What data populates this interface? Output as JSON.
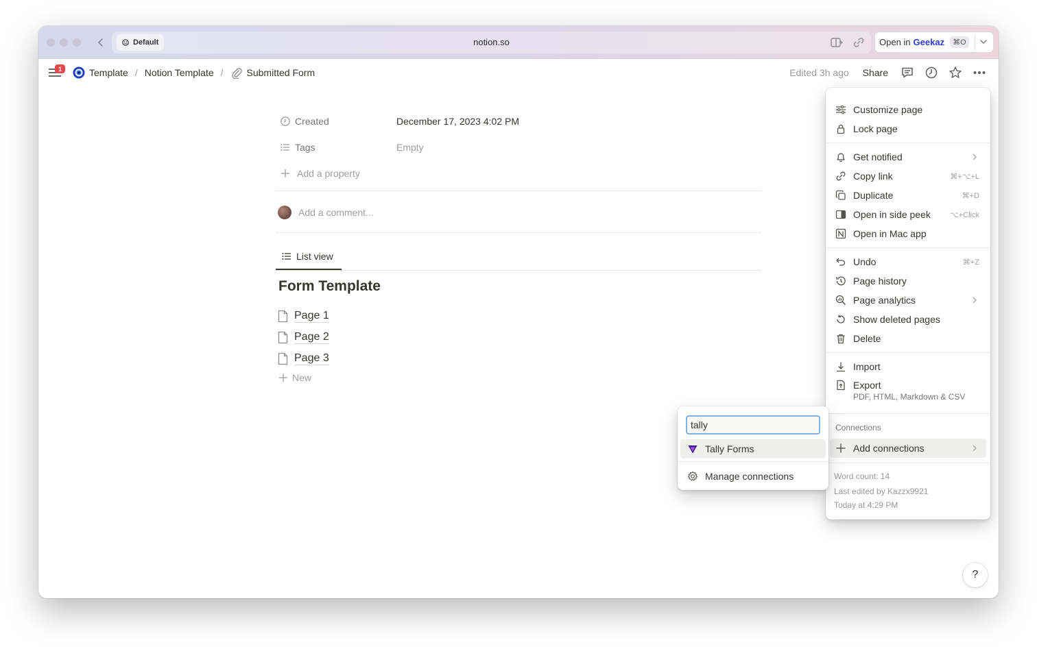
{
  "browser": {
    "profile": "Default",
    "url": "notion.so",
    "open_in": {
      "prefix": "Open in",
      "app": "Geekaz",
      "shortcut": "⌘O"
    }
  },
  "topbar": {
    "notification_count": "1",
    "breadcrumbs": [
      "Template",
      "Notion Template",
      "Submitted Form"
    ],
    "separator": "/",
    "edited": "Edited 3h ago",
    "share": "Share"
  },
  "properties": [
    {
      "label": "Created",
      "value": "December 17, 2023 4:02 PM"
    },
    {
      "label": "Tags",
      "value": "Empty"
    }
  ],
  "add_property": "Add a property",
  "comment_placeholder": "Add a comment...",
  "view_tab": "List view",
  "database": {
    "title": "Form Template",
    "pages": [
      "Page 1",
      "Page 2",
      "Page 3"
    ],
    "new_label": "New"
  },
  "menu": {
    "customize": "Customize page",
    "lock": "Lock page",
    "notified": "Get notified",
    "copy_link": {
      "label": "Copy link",
      "shortcut": "⌘+⌥+L"
    },
    "duplicate": {
      "label": "Duplicate",
      "shortcut": "⌘+D"
    },
    "side_peek": {
      "label": "Open in side peek",
      "shortcut": "⌥+Click"
    },
    "mac_app": "Open in Mac app",
    "undo": {
      "label": "Undo",
      "shortcut": "⌘+Z"
    },
    "history": "Page history",
    "analytics": "Page analytics",
    "deleted": "Show deleted pages",
    "delete": "Delete",
    "import": "Import",
    "export": {
      "label": "Export",
      "sub": "PDF, HTML, Markdown & CSV"
    },
    "connections_heading": "Connections",
    "add_connections": "Add connections",
    "word_count": "Word count: 14",
    "last_edited_by": "Last edited by Kazzx9921",
    "last_edited_at": "Today at 4:29 PM"
  },
  "connections_popup": {
    "search_value": "tally",
    "result": "Tally Forms",
    "manage": "Manage connections"
  },
  "help_label": "?"
}
